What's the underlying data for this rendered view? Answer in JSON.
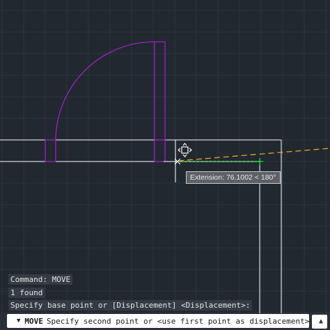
{
  "command_history": [
    "Command: MOVE",
    "1 found",
    "Specify base point or [Displacement] <Displacement>:"
  ],
  "tooltip": {
    "text": "Extension: 76.1002 < 180°"
  },
  "command_line": {
    "caret_icon": "dropdown-caret-icon",
    "command": "MOVE",
    "prompt": "Specify second point or <use first point as displacement>:"
  },
  "colors": {
    "background": "#212830",
    "grid": "#2b3440",
    "walls": "#ffffff",
    "door": "#a020c8",
    "tracking_green": "#22e022",
    "tracking_orange": "#f0a020"
  }
}
